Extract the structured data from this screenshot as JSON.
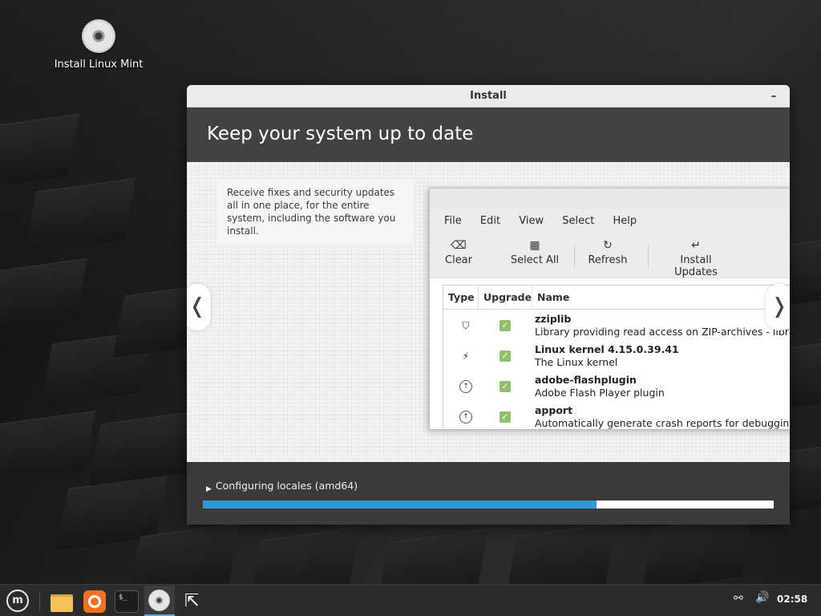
{
  "desktop": {
    "icons": [
      {
        "label": "Install Linux Mint",
        "icon": "disc-icon"
      }
    ]
  },
  "window": {
    "title": "Install",
    "minimize_glyph": "–",
    "header_title": "Keep your system up to date",
    "slide": {
      "caption": "Receive fixes and security updates all in one place, for the entire system, including the software you install.",
      "prev_glyph": "❬",
      "next_glyph": "❭",
      "screenshot": {
        "menu": [
          "File",
          "Edit",
          "View",
          "Select",
          "Help"
        ],
        "toolbar": [
          {
            "label": "Clear",
            "icon": "backspace-icon",
            "glyph": "⌫"
          },
          {
            "label": "Select All",
            "icon": "select-all-icon",
            "glyph": "▦"
          },
          {
            "label": "Refresh",
            "icon": "refresh-icon",
            "glyph": "↻"
          },
          {
            "label": "Install Updates",
            "icon": "install-updates-icon",
            "glyph": "↵"
          }
        ],
        "columns": [
          "Type",
          "Upgrade",
          "Name"
        ],
        "rows": [
          {
            "type_icon": "shield-icon",
            "type_glyph": "⛉",
            "checked": true,
            "name": "zziplib",
            "description": "Library providing read access on ZIP-archives - library"
          },
          {
            "type_icon": "bolt-icon",
            "type_glyph": "⚡",
            "checked": true,
            "name": "Linux kernel 4.15.0.39.41",
            "description": "The Linux kernel"
          },
          {
            "type_icon": "up-arrow-circle-icon",
            "type_glyph": "↑",
            "checked": true,
            "name": "adobe-flashplugin",
            "description": "Adobe Flash Player plugin"
          },
          {
            "type_icon": "up-arrow-circle-icon",
            "type_glyph": "↑",
            "checked": true,
            "name": "apport",
            "description": "Automatically generate crash reports for debugging"
          }
        ]
      }
    },
    "status": {
      "expander_glyph": "▶",
      "text": "Configuring locales (amd64)",
      "progress": 0.69,
      "progress_color": "#2d9ad6"
    }
  },
  "taskbar": {
    "menu_icon": "linux-mint-menu-icon",
    "menu_glyph": "m",
    "launchers": [
      "folder-icon",
      "firefox-icon",
      "terminal-icon",
      "installer-disc-icon",
      "cursor-icon"
    ],
    "terminal_glyph": "$_",
    "cursor_glyph": "⇱",
    "tray": {
      "network_glyph": "⚯",
      "volume_glyph": "🔊",
      "clock": "02:58"
    }
  }
}
